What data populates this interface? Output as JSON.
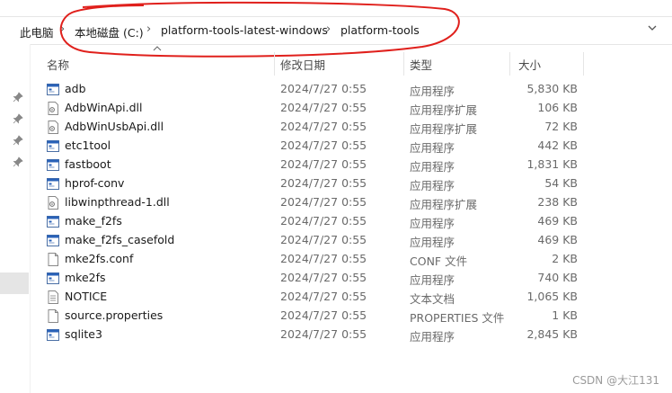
{
  "breadcrumb": {
    "items": [
      "此电脑",
      "本地磁盘 (C:)",
      "platform-tools-latest-windows",
      "platform-tools"
    ],
    "separator": "›"
  },
  "columns": {
    "name": "名称",
    "modified": "修改日期",
    "type": "类型",
    "size": "大小"
  },
  "files": [
    {
      "name": "adb",
      "modified": "2024/7/27 0:55",
      "type": "应用程序",
      "size": "5,830 KB",
      "icon": "exe-icon"
    },
    {
      "name": "AdbWinApi.dll",
      "modified": "2024/7/27 0:55",
      "type": "应用程序扩展",
      "size": "106 KB",
      "icon": "dll-icon"
    },
    {
      "name": "AdbWinUsbApi.dll",
      "modified": "2024/7/27 0:55",
      "type": "应用程序扩展",
      "size": "72 KB",
      "icon": "dll-icon"
    },
    {
      "name": "etc1tool",
      "modified": "2024/7/27 0:55",
      "type": "应用程序",
      "size": "442 KB",
      "icon": "exe-icon"
    },
    {
      "name": "fastboot",
      "modified": "2024/7/27 0:55",
      "type": "应用程序",
      "size": "1,831 KB",
      "icon": "exe-icon"
    },
    {
      "name": "hprof-conv",
      "modified": "2024/7/27 0:55",
      "type": "应用程序",
      "size": "54 KB",
      "icon": "exe-icon"
    },
    {
      "name": "libwinpthread-1.dll",
      "modified": "2024/7/27 0:55",
      "type": "应用程序扩展",
      "size": "238 KB",
      "icon": "dll-icon"
    },
    {
      "name": "make_f2fs",
      "modified": "2024/7/27 0:55",
      "type": "应用程序",
      "size": "469 KB",
      "icon": "exe-icon"
    },
    {
      "name": "make_f2fs_casefold",
      "modified": "2024/7/27 0:55",
      "type": "应用程序",
      "size": "469 KB",
      "icon": "exe-icon"
    },
    {
      "name": "mke2fs.conf",
      "modified": "2024/7/27 0:55",
      "type": "CONF 文件",
      "size": "2 KB",
      "icon": "file-icon"
    },
    {
      "name": "mke2fs",
      "modified": "2024/7/27 0:55",
      "type": "应用程序",
      "size": "740 KB",
      "icon": "exe-icon"
    },
    {
      "name": "NOTICE",
      "modified": "2024/7/27 0:55",
      "type": "文本文档",
      "size": "1,065 KB",
      "icon": "text-file-icon"
    },
    {
      "name": "source.properties",
      "modified": "2024/7/27 0:55",
      "type": "PROPERTIES 文件",
      "size": "1 KB",
      "icon": "file-icon"
    },
    {
      "name": "sqlite3",
      "modified": "2024/7/27 0:55",
      "type": "应用程序",
      "size": "2,845 KB",
      "icon": "exe-icon"
    }
  ],
  "watermark": "CSDN @大江131",
  "colors": {
    "annotation": "#e0201c",
    "exe_icon_blue": "#2a62b8",
    "selection": "#e5e5e5"
  }
}
